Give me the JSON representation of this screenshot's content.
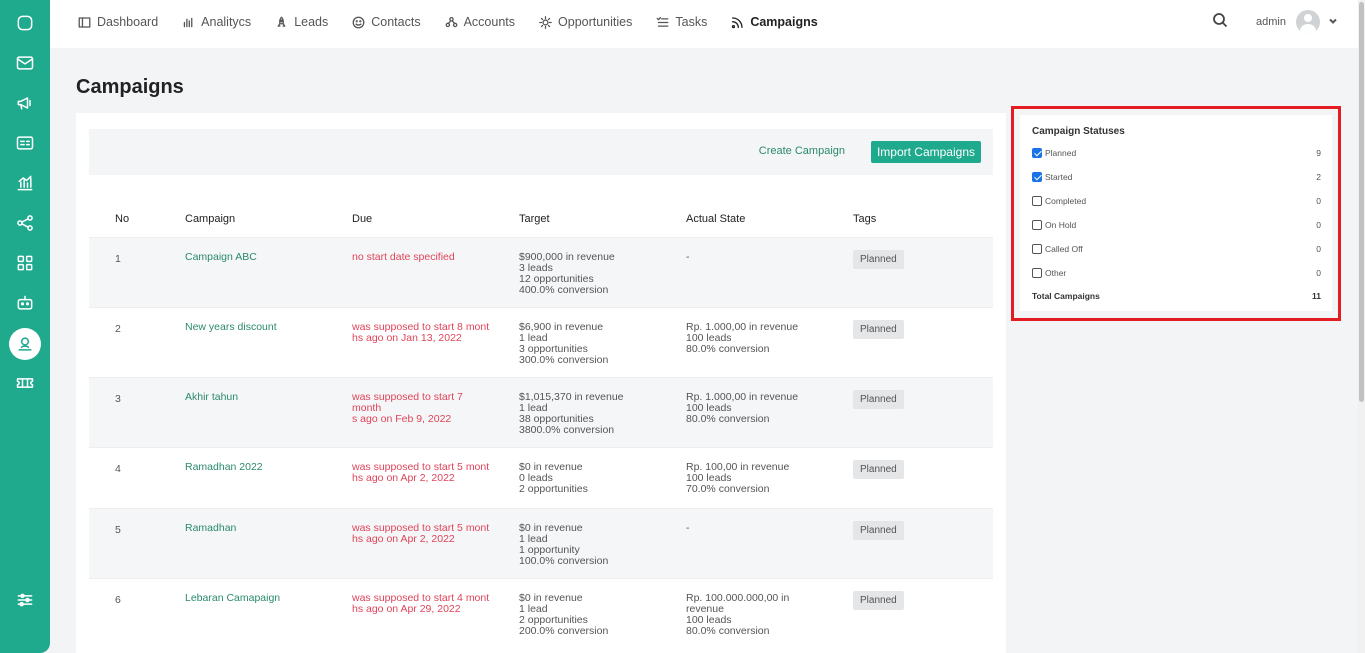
{
  "nav": {
    "items": [
      {
        "label": "Dashboard",
        "icon": "dashboard-icon",
        "active": false
      },
      {
        "label": "Analitycs",
        "icon": "analytics-icon",
        "active": false
      },
      {
        "label": "Leads",
        "icon": "leads-icon",
        "active": false
      },
      {
        "label": "Contacts",
        "icon": "contacts-icon",
        "active": false
      },
      {
        "label": "Accounts",
        "icon": "accounts-icon",
        "active": false
      },
      {
        "label": "Opportunities",
        "icon": "opportunities-icon",
        "active": false
      },
      {
        "label": "Tasks",
        "icon": "tasks-icon",
        "active": false
      },
      {
        "label": "Campaigns",
        "icon": "campaigns-icon",
        "active": true
      }
    ],
    "user": "admin"
  },
  "page_title": "Campaigns",
  "actions": {
    "create": "Create Campaign",
    "import": "Import Campaigns"
  },
  "table": {
    "headers": [
      "No",
      "Campaign",
      "Due",
      "Target",
      "Actual State",
      "Tags"
    ],
    "rows": [
      {
        "no": "1",
        "campaign": "Campaign ABC",
        "due": "no start date specified",
        "target": [
          "$900,000 in revenue",
          "3 leads",
          "12 opportunities",
          "400.0% conversion"
        ],
        "actual": [
          "-"
        ],
        "tag": "Planned"
      },
      {
        "no": "2",
        "campaign": "New years discount",
        "due": "was supposed to start 8 mont\nhs ago on Jan 13, 2022",
        "target": [
          "$6,900 in revenue",
          "1 lead",
          "3 opportunities",
          "300.0% conversion"
        ],
        "actual": [
          "Rp. 1.000,00 in revenue",
          "100 leads",
          "80.0% conversion"
        ],
        "tag": "Planned"
      },
      {
        "no": "3",
        "campaign": "Akhir tahun",
        "due": "was supposed to start 7 month\ns ago on Feb 9, 2022",
        "target": [
          "$1,015,370 in revenue",
          "1 lead",
          "38 opportunities",
          "3800.0% conversion"
        ],
        "actual": [
          "Rp. 1.000,00 in revenue",
          "100 leads",
          "80.0% conversion"
        ],
        "tag": "Planned"
      },
      {
        "no": "4",
        "campaign": "Ramadhan 2022",
        "due": "was supposed to start 5 mont\nhs ago on Apr 2, 2022",
        "target": [
          "$0 in revenue",
          "0 leads",
          "2 opportunities"
        ],
        "actual": [
          "Rp. 100,00 in revenue",
          "100 leads",
          "70.0% conversion"
        ],
        "tag": "Planned"
      },
      {
        "no": "5",
        "campaign": "Ramadhan",
        "due": "was supposed to start 5 mont\nhs ago on Apr 2, 2022",
        "target": [
          "$0 in revenue",
          "1 lead",
          "1 opportunity",
          "100.0% conversion"
        ],
        "actual": [
          "-"
        ],
        "tag": "Planned"
      },
      {
        "no": "6",
        "campaign": "Lebaran Camapaign",
        "due": "was supposed to start 4 mont\nhs ago on Apr 29, 2022",
        "target": [
          "$0 in revenue",
          "1 lead",
          "2 opportunities",
          "200.0% conversion"
        ],
        "actual": [
          "Rp. 100.000.000,00 in revenue",
          "100 leads",
          "80.0% conversion"
        ],
        "tag": "Planned"
      }
    ]
  },
  "statuses": {
    "title": "Campaign Statuses",
    "items": [
      {
        "label": "Planned",
        "count": "9",
        "checked": true
      },
      {
        "label": "Started",
        "count": "2",
        "checked": true
      },
      {
        "label": "Completed",
        "count": "0",
        "checked": false
      },
      {
        "label": "On Hold",
        "count": "0",
        "checked": false
      },
      {
        "label": "Called Off",
        "count": "0",
        "checked": false
      },
      {
        "label": "Other",
        "count": "0",
        "checked": false
      }
    ],
    "total_label": "Total Campaigns",
    "total_count": "11"
  },
  "colors": {
    "brand": "#1fa98d",
    "due": "#e0445a",
    "highlight": "#e31b23"
  }
}
